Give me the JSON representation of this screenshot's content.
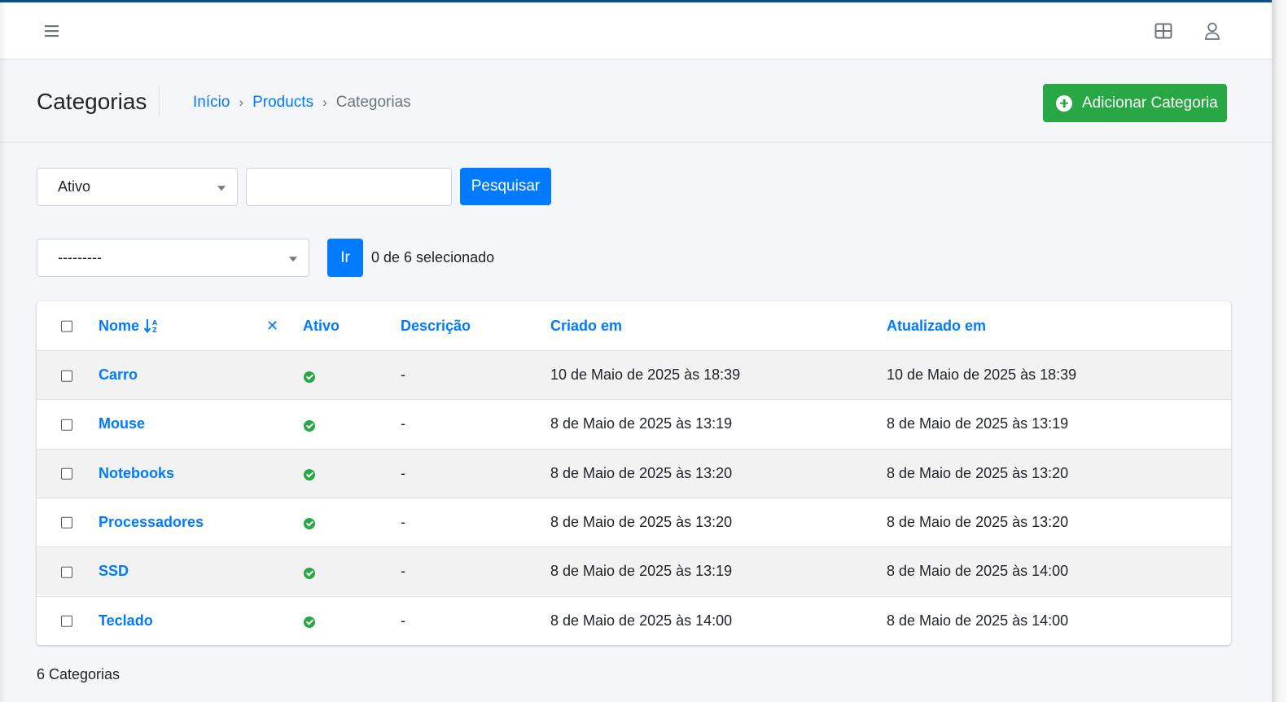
{
  "navbar": {
    "menu_icon": "hamburger-menu-icon",
    "apps_icon": "grid-apps-icon",
    "user_icon": "user-icon"
  },
  "header": {
    "title": "Categorias",
    "breadcrumb": [
      {
        "label": "Início",
        "link": true
      },
      {
        "label": "Products",
        "link": true
      },
      {
        "label": "Categorias",
        "link": false
      }
    ],
    "breadcrumb_separator": "›",
    "add_button_label": "Adicionar Categoria"
  },
  "filters": {
    "status_value": "Ativo",
    "search_value": "",
    "search_button_label": "Pesquisar"
  },
  "actions": {
    "select_value": "---------",
    "go_button_label": "Ir",
    "selected_text": "0 de 6 selecionado"
  },
  "table": {
    "columns": {
      "name": "Nome",
      "clear_sort": "✕",
      "active": "Ativo",
      "description": "Descrição",
      "created": "Criado em",
      "updated": "Atualizado em"
    },
    "rows": [
      {
        "name": "Carro",
        "active": true,
        "description": "-",
        "created": "10 de Maio de 2025 às 18:39",
        "updated": "10 de Maio de 2025 às 18:39"
      },
      {
        "name": "Mouse",
        "active": true,
        "description": "-",
        "created": "8 de Maio de 2025 às 13:19",
        "updated": "8 de Maio de 2025 às 13:19"
      },
      {
        "name": "Notebooks",
        "active": true,
        "description": "-",
        "created": "8 de Maio de 2025 às 13:20",
        "updated": "8 de Maio de 2025 às 13:20"
      },
      {
        "name": "Processadores",
        "active": true,
        "description": "-",
        "created": "8 de Maio de 2025 às 13:20",
        "updated": "8 de Maio de 2025 às 13:20"
      },
      {
        "name": "SSD",
        "active": true,
        "description": "-",
        "created": "8 de Maio de 2025 às 13:19",
        "updated": "8 de Maio de 2025 às 14:00"
      },
      {
        "name": "Teclado",
        "active": true,
        "description": "-",
        "created": "8 de Maio de 2025 às 14:00",
        "updated": "8 de Maio de 2025 às 14:00"
      }
    ]
  },
  "footer": {
    "count_text": "6 Categorias"
  },
  "colors": {
    "primary": "#007bff",
    "success": "#28a745",
    "top_border": "#0b4f8a"
  }
}
